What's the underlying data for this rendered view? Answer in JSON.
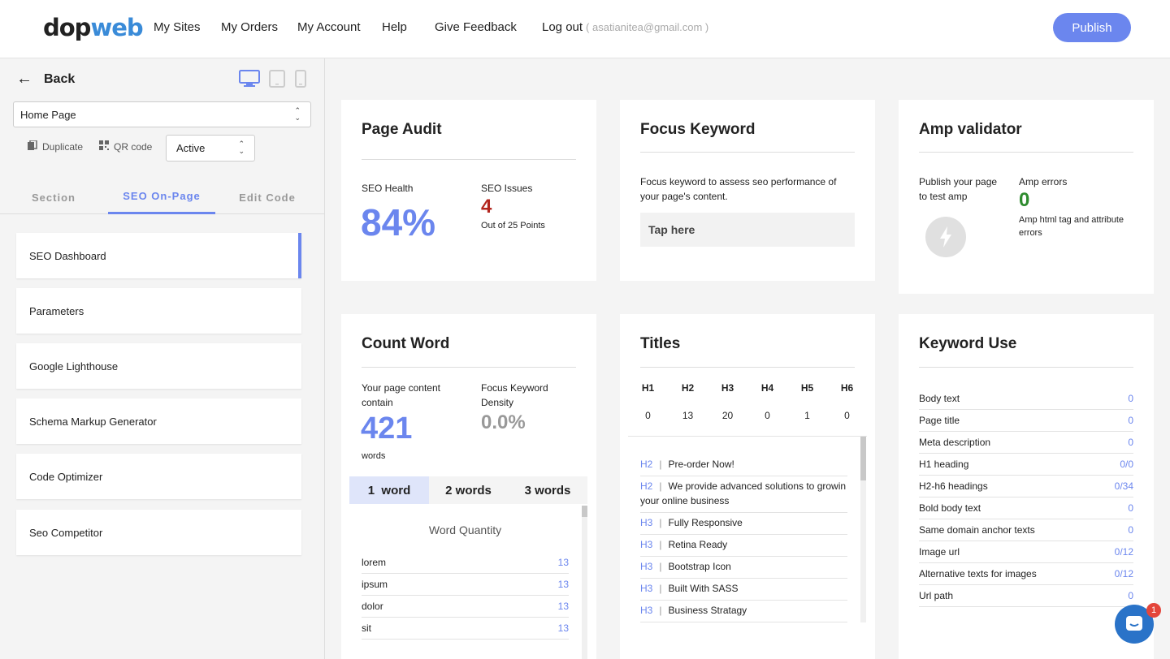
{
  "header": {
    "logo_part1": "dop",
    "logo_part2": "web",
    "nav": [
      "My Sites",
      "My Orders",
      "My Account",
      "Help",
      "Give Feedback"
    ],
    "logout_label": "Log out",
    "email": "( asatianitea@gmail.com )",
    "publish_label": "Publish",
    "accent_color": "#6b86ee"
  },
  "sidebar": {
    "back_label": "Back",
    "page_select_value": "Home Page",
    "duplicate_label": "Duplicate",
    "qr_label": "QR code",
    "status_value": "Active",
    "tabs": [
      "Section",
      "SEO On-Page",
      "Edit Code"
    ],
    "active_tab": "SEO On-Page",
    "items": [
      "SEO Dashboard",
      "Parameters",
      "Google Lighthouse",
      "Schema Markup Generator",
      "Code Optimizer",
      "Seo Competitor"
    ]
  },
  "page_audit": {
    "title": "Page Audit",
    "health_label": "SEO Health",
    "health_value": "84%",
    "issues_label": "SEO Issues",
    "issues_value": "4",
    "issues_sub": "Out of 25 Points"
  },
  "focus_keyword": {
    "title": "Focus Keyword",
    "desc": "Focus keyword to assess seo performance of your page's content.",
    "input_placeholder": "Tap here"
  },
  "amp": {
    "title": "Amp validator",
    "publish_text": "Publish your page to test amp",
    "errors_label": "Amp errors",
    "errors_value": "0",
    "errors_desc": "Amp html tag and attribute errors"
  },
  "count_word": {
    "title": "Count Word",
    "content_label": "Your page content contain",
    "word_count": "421",
    "words_label": "words",
    "density_label": "Focus Keyword Density",
    "density_value": "0.0%",
    "tabs": [
      "1  word",
      "2 words",
      "3 words"
    ],
    "quantity_title": "Word Quantity",
    "rows": [
      {
        "word": "lorem",
        "count": "13"
      },
      {
        "word": "ipsum",
        "count": "13"
      },
      {
        "word": "dolor",
        "count": "13"
      },
      {
        "word": "sit",
        "count": "13"
      }
    ]
  },
  "titles": {
    "title": "Titles",
    "headings": [
      "H1",
      "H2",
      "H3",
      "H4",
      "H5",
      "H6"
    ],
    "counts": [
      "0",
      "13",
      "20",
      "0",
      "1",
      "0"
    ],
    "items": [
      {
        "tag": "H2",
        "text": "Pre-order Now!"
      },
      {
        "tag": "H2",
        "text": "We provide advanced solutions to growin your online business"
      },
      {
        "tag": "H3",
        "text": "Fully Responsive"
      },
      {
        "tag": "H3",
        "text": "Retina Ready"
      },
      {
        "tag": "H3",
        "text": "Bootstrap Icon"
      },
      {
        "tag": "H3",
        "text": "Built With SASS"
      },
      {
        "tag": "H3",
        "text": "Business Stratagy"
      }
    ]
  },
  "keyword_use": {
    "title": "Keyword Use",
    "rows": [
      {
        "label": "Body text",
        "value": "0"
      },
      {
        "label": "Page title",
        "value": "0"
      },
      {
        "label": "Meta description",
        "value": "0"
      },
      {
        "label": "H1 heading",
        "value": "0/0"
      },
      {
        "label": "H2-h6 headings",
        "value": "0/34"
      },
      {
        "label": "Bold body text",
        "value": "0"
      },
      {
        "label": "Same domain anchor texts",
        "value": "0"
      },
      {
        "label": "Image url",
        "value": "0/12"
      },
      {
        "label": "Alternative texts for images",
        "value": "0/12"
      },
      {
        "label": "Url path",
        "value": "0"
      }
    ]
  },
  "chat": {
    "badge": "1"
  }
}
